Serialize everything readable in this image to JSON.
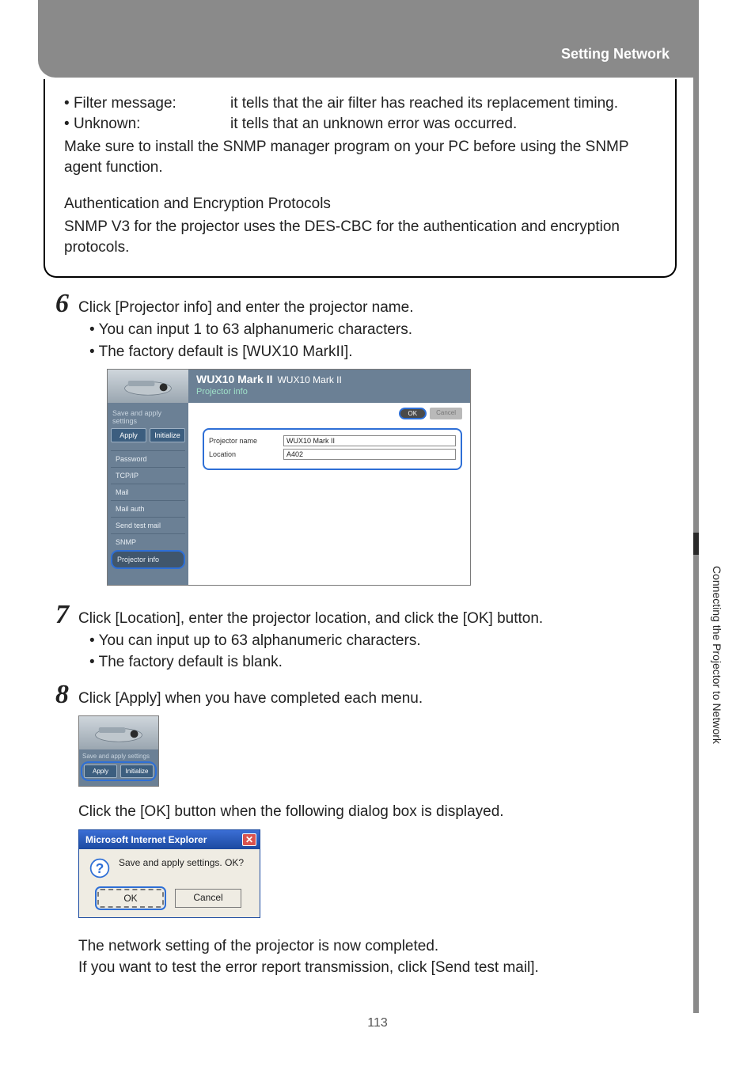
{
  "header": {
    "title": "Setting Network"
  },
  "sidelabel": "Connecting the Projector to Network",
  "box": {
    "filter_label": "Filter message:",
    "filter_text": "it tells that the air filter has reached its replacement timing.",
    "unknown_label": "Unknown:",
    "unknown_text": "it tells that an unknown error was occurred.",
    "line1": "Make sure to install the SNMP manager program on your PC before using the SNMP agent function.",
    "heading": "Authentication and Encryption Protocols",
    "line2": "SNMP V3 for the projector uses the DES-CBC for the authentication and encryption protocols."
  },
  "step6": {
    "num": "6",
    "title": "Click [Projector info] and enter the projector name.",
    "b1": "You can input 1 to 63 alphanumeric characters.",
    "b2": "The factory default is [WUX10 MarkII]."
  },
  "fig1": {
    "brand": "WUX10 Mark II",
    "brand_small": "WUX10 Mark II",
    "subtitle": "Projector info",
    "save": "Save and apply settings",
    "apply": "Apply",
    "init": "Initialize",
    "menu": [
      "Password",
      "TCP/IP",
      "Mail",
      "Mail auth",
      "Send test mail",
      "SNMP",
      "Projector info"
    ],
    "ok": "OK",
    "cancel": "Cancel",
    "f1_label": "Projector name",
    "f1_value": "WUX10 Mark II",
    "f2_label": "Location",
    "f2_value": "A402"
  },
  "step7": {
    "num": "7",
    "title": "Click [Location], enter the projector location, and click the [OK] button.",
    "b1": "You can input up to 63 alphanumeric characters.",
    "b2": "The factory default is blank."
  },
  "step8": {
    "num": "8",
    "title": "Click [Apply] when you have completed each menu.",
    "line2": "Click the [OK] button when the following dialog box is displayed.",
    "after1": "The network setting of the projector is now completed.",
    "after2": "If you want to test the error report transmission, click [Send test mail]."
  },
  "fig2": {
    "save": "Save and apply settings",
    "apply": "Apply",
    "init": "Initialize"
  },
  "dialog": {
    "title": "Microsoft Internet Explorer",
    "msg": "Save and apply settings. OK?",
    "ok": "OK",
    "cancel": "Cancel"
  },
  "pagenum": "113"
}
